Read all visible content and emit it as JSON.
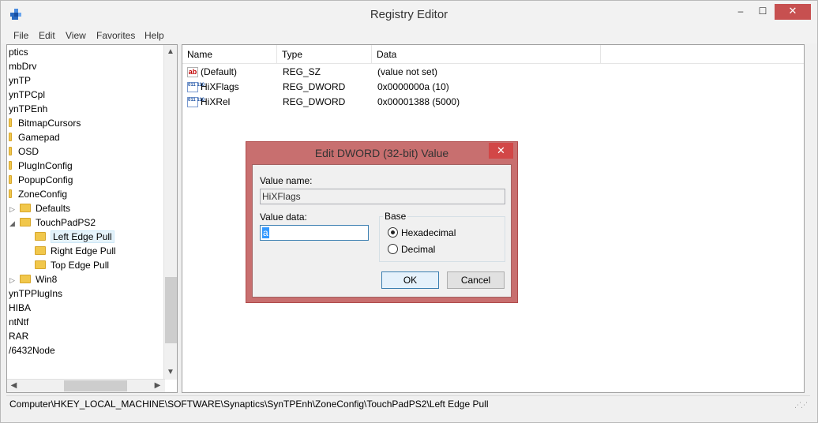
{
  "window": {
    "title": "Registry Editor",
    "controls": {
      "minimize": "–",
      "maximize": "☐",
      "close": "✕"
    }
  },
  "menu": [
    "File",
    "Edit",
    "View",
    "Favorites",
    "Help"
  ],
  "tree": {
    "items": [
      {
        "label": "ptics",
        "level": 0
      },
      {
        "label": "mbDrv",
        "level": 0
      },
      {
        "label": "ynTP",
        "level": 0
      },
      {
        "label": "ynTPCpl",
        "level": 0
      },
      {
        "label": "ynTPEnh",
        "level": 0
      },
      {
        "label": "BitmapCursors",
        "level": 1
      },
      {
        "label": "Gamepad",
        "level": 1
      },
      {
        "label": "OSD",
        "level": 1
      },
      {
        "label": "PlugInConfig",
        "level": 1
      },
      {
        "label": "PopupConfig",
        "level": 1
      },
      {
        "label": "ZoneConfig",
        "level": 1
      },
      {
        "label": "Defaults",
        "level": 2
      },
      {
        "label": "TouchPadPS2",
        "level": 2
      },
      {
        "label": "Left Edge Pull",
        "level": 3
      },
      {
        "label": "Right Edge Pull",
        "level": 3
      },
      {
        "label": "Top Edge Pull",
        "level": 3
      },
      {
        "label": "Win8",
        "level": 2
      },
      {
        "label": "ynTPPlugIns",
        "level": 0
      },
      {
        "label": "HIBA",
        "level": 0
      },
      {
        "label": "ntNtf",
        "level": 0
      },
      {
        "label": "RAR",
        "level": 0
      },
      {
        "label": "/6432Node",
        "level": 0
      }
    ],
    "selected": "Left Edge Pull"
  },
  "list": {
    "columns": [
      "Name",
      "Type",
      "Data"
    ],
    "rows": [
      {
        "icon": "string-value-icon",
        "glyph": "ab",
        "name": "(Default)",
        "type": "REG_SZ",
        "data": "(value not set)"
      },
      {
        "icon": "dword-value-icon",
        "glyph": "011 110",
        "name": "HiXFlags",
        "type": "REG_DWORD",
        "data": "0x0000000a (10)"
      },
      {
        "icon": "dword-value-icon",
        "glyph": "011 110",
        "name": "HiXRel",
        "type": "REG_DWORD",
        "data": "0x00001388 (5000)"
      }
    ]
  },
  "status": {
    "path": "Computer\\HKEY_LOCAL_MACHINE\\SOFTWARE\\Synaptics\\SynTPEnh\\ZoneConfig\\TouchPadPS2\\Left Edge Pull"
  },
  "dialog": {
    "title": "Edit DWORD (32-bit) Value",
    "value_name_label": "Value name:",
    "value_name": "HiXFlags",
    "value_data_label": "Value data:",
    "value_data": "a",
    "base_label": "Base",
    "hex_label": "Hexadecimal",
    "dec_label": "Decimal",
    "selected_base": "Hexadecimal",
    "ok_label": "OK",
    "cancel_label": "Cancel",
    "close": "✕"
  },
  "colors": {
    "dialog_frame": "#c86f6f",
    "close_button": "#c75050",
    "folder": "#f1c74b",
    "selection": "#3399ff"
  }
}
